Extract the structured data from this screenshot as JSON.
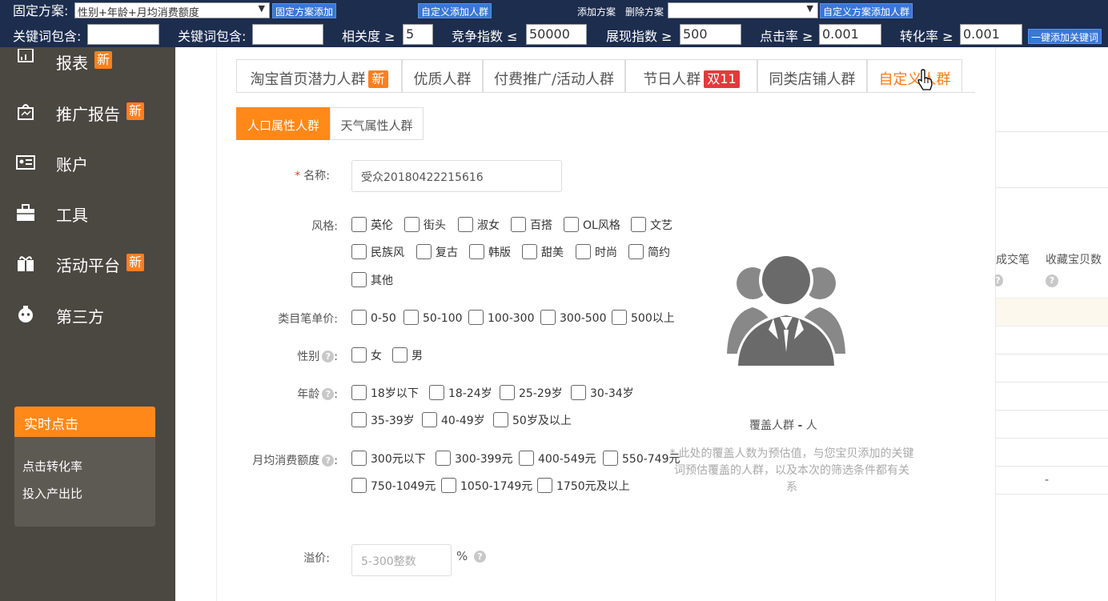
{
  "toolbar": {
    "fixed_plan_label": "固定方案:",
    "fixed_plan_value": "性别+年龄+月均消费额度",
    "add_fixed_plan": "固定方案添加",
    "custom_add_audience": "自定义添加人群",
    "add_plan": "添加方案",
    "delete_plan": "删除方案",
    "plan_select_value": "",
    "custom_plan_add_audience": "自定义方案添加人群"
  },
  "filters": {
    "keyword1_label": "关键词包含:",
    "keyword1_value": "",
    "keyword2_label": "关键词包含:",
    "keyword2_value": "",
    "relevance_label": "相关度 ≥",
    "relevance_value": "5",
    "competition_label": "竞争指数 ≤",
    "competition_value": "50000",
    "impression_label": "展现指数 ≥",
    "impression_value": "500",
    "ctr_label": "点击率 ≥",
    "ctr_value": "0.001",
    "cvr_label": "转化率 ≥",
    "cvr_value": "0.001",
    "one_click_add": "一键添加关键词"
  },
  "sidebar": {
    "items": [
      {
        "label": "报表",
        "badge": "新"
      },
      {
        "label": "推广报告",
        "badge": "新"
      },
      {
        "label": "账户",
        "badge": ""
      },
      {
        "label": "工具",
        "badge": ""
      },
      {
        "label": "活动平台",
        "badge": "新"
      },
      {
        "label": "第三方",
        "badge": ""
      }
    ],
    "realtime": {
      "title": "实时点击",
      "items": [
        "点击转化率",
        "投入产出比"
      ]
    }
  },
  "tabs": [
    {
      "label": "淘宝首页潜力人群",
      "badge": "新"
    },
    {
      "label": "优质人群",
      "badge": ""
    },
    {
      "label": "付费推广/活动人群",
      "badge": ""
    },
    {
      "label": "节日人群",
      "badge": "双11"
    },
    {
      "label": "同类店铺人群",
      "badge": ""
    },
    {
      "label": "自定义人群",
      "badge": ""
    }
  ],
  "subtabs": [
    "人口属性人群",
    "天气属性人群"
  ],
  "form": {
    "name_label": "名称:",
    "name_required": "*",
    "name_value": "受众20180422215616",
    "style_label": "风格:",
    "style_options": [
      "英伦",
      "街头",
      "淑女",
      "百搭",
      "OL风格",
      "文艺",
      "民族风",
      "复古",
      "韩版",
      "甜美",
      "时尚",
      "简约",
      "其他"
    ],
    "price_label": "类目笔单价:",
    "price_options": [
      "0-50",
      "50-100",
      "100-300",
      "300-500",
      "500以上"
    ],
    "gender_label": "性别",
    "gender_options": [
      "女",
      "男"
    ],
    "age_label": "年龄",
    "age_options": [
      "18岁以下",
      "18-24岁",
      "25-29岁",
      "30-34岁",
      "35-39岁",
      "40-49岁",
      "50岁及以上"
    ],
    "spend_label": "月均消费额度",
    "spend_options": [
      "300元以下",
      "300-399元",
      "400-549元",
      "550-749元",
      "750-1049元",
      "1050-1749元",
      "1750元及以上"
    ],
    "premium_label": "溢价:",
    "premium_placeholder": "5-300整数",
    "premium_unit": "%",
    "colon": ":",
    "help": "?"
  },
  "coverage": {
    "text_prefix": "覆盖人群",
    "value": "-",
    "text_suffix": "人",
    "note_star": "*",
    "note": "此处的覆盖人数为预估值，与您宝贝添加的关键词预估覆盖的人群，以及本次的筛选条件都有关系"
  },
  "right_table": {
    "col1": "成交笔",
    "col2": "收藏宝贝数",
    "dash": "-"
  },
  "colors": {
    "toolbar_bg": "#1c2d4e",
    "sidebar_bg": "#4b4741",
    "accent": "#ff7a1a",
    "button_blue": "#3a77d6",
    "badge_red": "#e4393c"
  }
}
